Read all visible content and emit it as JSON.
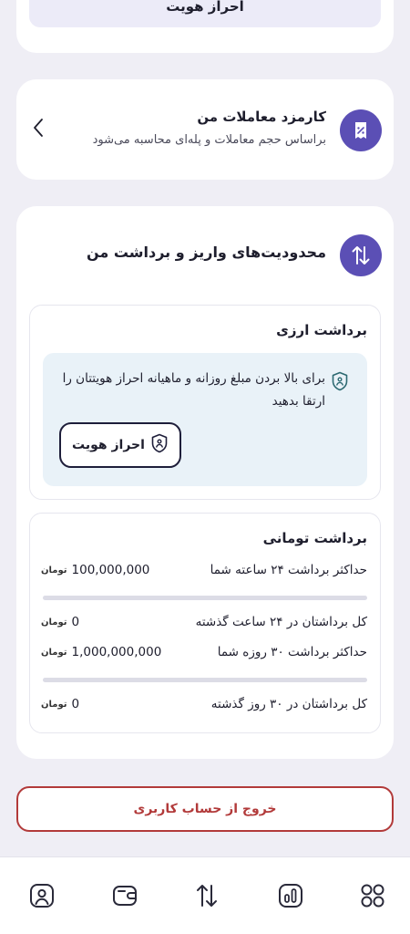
{
  "top_card": {
    "verify_button": "احراز هویت"
  },
  "fee_card": {
    "title": "کارمزد معاملات من",
    "subtitle": "براساس حجم معاملات و پله‌ای محاسبه می‌شود",
    "icon": "receipt-percent-icon"
  },
  "limits_card": {
    "title": "محدودیت‌های واریز و برداشت من",
    "icon": "arrows-up-down-icon",
    "fx_withdrawal": {
      "title": "برداشت ارزی",
      "alert_text": "برای بالا بردن مبلغ روزانه و ماهیانه احراز هویتتان را ارتقا بدهید",
      "button": "احراز هویت"
    },
    "toman_withdrawal": {
      "title": "برداشت تومانی",
      "unit": "تومان",
      "rows": [
        {
          "label": "حداکثر برداشت ۲۴ ساعته شما",
          "value": "100,000,000"
        },
        {
          "label": "کل برداشتان در ۲۴ ساعت گذشته",
          "value": "0"
        },
        {
          "label": "حداکثر برداشت ۳۰ روزه شما",
          "value": "1,000,000,000"
        },
        {
          "label": "کل برداشتان در ۳۰ روز گذشته",
          "value": "0"
        }
      ],
      "daily_usage_fraction": 0,
      "monthly_usage_fraction": 0
    }
  },
  "logout_button": "خروج از حساب کاربری",
  "bottom_nav": [
    "profile-icon",
    "wallet-icon",
    "transfer-icon",
    "chart-icon",
    "apps-grid-icon"
  ],
  "colors": {
    "accent": "#5b4fb5",
    "danger": "#b23a3a",
    "info_bg": "#e9f2f8"
  }
}
